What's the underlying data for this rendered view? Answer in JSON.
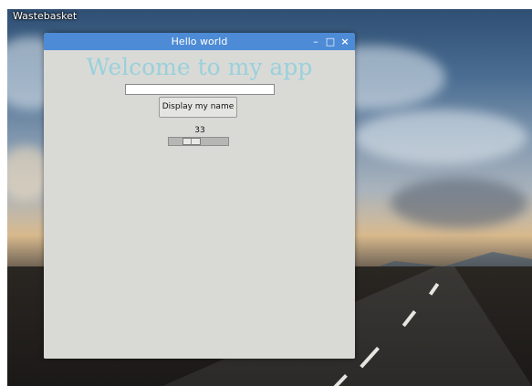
{
  "desktop": {
    "wastebasket_label": "Wastebasket"
  },
  "window": {
    "title": "Hello world",
    "controls": {
      "minimize_glyph": "–",
      "maximize_glyph": "□",
      "close_glyph": "×"
    },
    "titlebar_color": "#4d8bd6"
  },
  "app": {
    "heading": "Welcome to my app",
    "heading_color": "#9ad0dc",
    "name_entry": {
      "value": "",
      "placeholder": ""
    },
    "display_button_label": "Display my name",
    "scale": {
      "value": "33",
      "min": 0,
      "max": 100,
      "fraction": 0.33
    }
  }
}
